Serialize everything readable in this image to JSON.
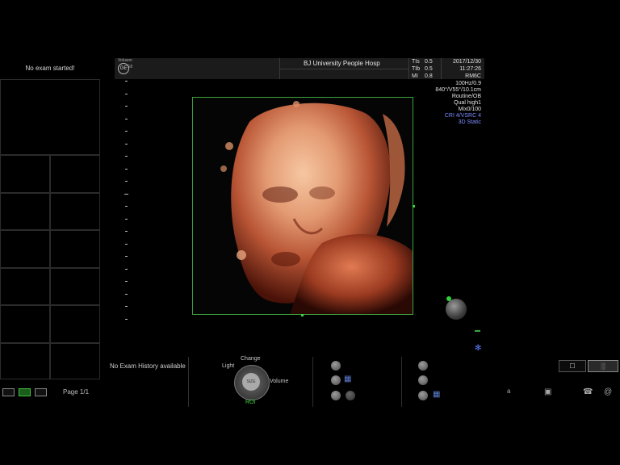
{
  "header": {
    "probe_brand_top": "Voluson",
    "probe_brand_bottom": "E8",
    "logo_text": "GE",
    "hospital": "BJ  University  People Hosp"
  },
  "indices": [
    {
      "label": "TIs",
      "value": "0.5"
    },
    {
      "label": "TIb",
      "value": "0.5"
    },
    {
      "label": "MI",
      "value": "0.8"
    }
  ],
  "datetime": {
    "date": "2017/12/30",
    "time": "11:27:26"
  },
  "acquisition": {
    "probe": "RM6C",
    "freq": "100Hz/0.9",
    "geometry": "840°/V55°/10.1cm",
    "preset": "Routine/OB",
    "quality": "Qual high1",
    "mix": "Mix0/100",
    "cri": "CRI 4/VSRC 4",
    "mode": "3D Static"
  },
  "left": {
    "status": "No exam started!",
    "page": "Page 1/1"
  },
  "bottom": {
    "history": "No Exam History available",
    "knob": {
      "top": "Change",
      "left": "Light",
      "right": "Volume",
      "bottom": "ROI",
      "center": "SIZE"
    }
  },
  "icons": {
    "layout_1x1": "single-layout-icon",
    "layout_2x2": "grid-layout-icon",
    "layout_list": "list-layout-icon",
    "save": "save-icon",
    "network": "network-icon",
    "phone": "phone-icon",
    "help": "at-icon"
  },
  "colors": {
    "accent_green": "#3da23d",
    "info_blue": "#7d8cff"
  }
}
